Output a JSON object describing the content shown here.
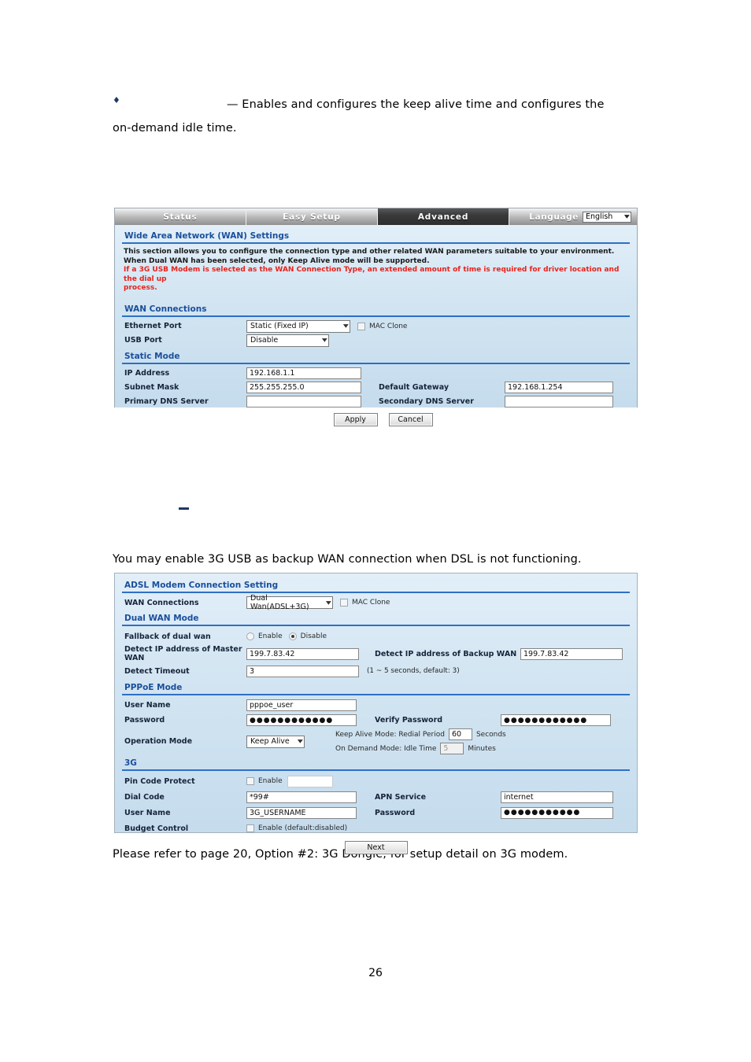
{
  "document": {
    "bullet_glyph": "♦",
    "para1": "— Enables and configures the keep alive time and configures the",
    "para1_line2": "on-demand idle time.",
    "para2": "You may enable 3G USB as backup WAN connection when DSL is not functioning.",
    "para3": "Please refer to page 20, Option #2: 3G Dongle, for setup detail on 3G modem.",
    "page_number": "26"
  },
  "colors": {
    "accent_blue": "#1a4f9c",
    "divider_blue": "#2f6fc4",
    "warning_red": "#e8221c",
    "panel_bg": "#d3e5f2",
    "active_tab": "#2e2e2e"
  },
  "screenshot_wan": {
    "nav": {
      "tabs": [
        {
          "label": "Status",
          "active": false
        },
        {
          "label": "Easy Setup",
          "active": false
        },
        {
          "label": "Advanced",
          "active": true
        }
      ],
      "language_label": "Language",
      "language_value": "English"
    },
    "title": "Wide Area Network (WAN) Settings",
    "notice": {
      "line1": "This section allows you to configure the connection type and other related WAN parameters suitable to your environment.",
      "line2": "When Dual WAN has been selected, only Keep Alive mode will be supported.",
      "line3": "If a 3G USB Modem is selected as the WAN Connection Type, an extended amount of time is required for driver location and the dial up",
      "line4": "process."
    },
    "section_wan_connections": "WAN Connections",
    "ethernet_port": {
      "label": "Ethernet Port",
      "value": "Static (Fixed IP)"
    },
    "mac_clone": {
      "label": "MAC Clone",
      "checked": false
    },
    "usb_port": {
      "label": "USB Port",
      "value": "Disable"
    },
    "section_static_mode": "Static Mode",
    "ip_address": {
      "label": "IP Address",
      "value": "192.168.1.1"
    },
    "subnet_mask": {
      "label": "Subnet Mask",
      "value": "255.255.255.0"
    },
    "default_gateway": {
      "label": "Default Gateway",
      "value": "192.168.1.254"
    },
    "primary_dns": {
      "label": "Primary DNS Server",
      "value": ""
    },
    "secondary_dns": {
      "label": "Secondary DNS Server",
      "value": ""
    },
    "apply_button": "Apply",
    "cancel_button": "Cancel"
  },
  "screenshot_adsl": {
    "title": "ADSL Modem Connection Setting",
    "wan_connections": {
      "label": "WAN Connections",
      "value": "Dual Wan(ADSL+3G)"
    },
    "mac_clone": {
      "label": "MAC Clone",
      "checked": false
    },
    "section_dual_wan_mode": "Dual WAN Mode",
    "fallback": {
      "label": "Fallback of dual wan",
      "option_enable": "Enable",
      "option_disable": "Disable",
      "selected": "Disable"
    },
    "detect_master": {
      "label": "Detect IP address of Master WAN",
      "value": "199.7.83.42"
    },
    "detect_backup": {
      "label": "Detect IP address of Backup WAN",
      "value": "199.7.83.42"
    },
    "detect_timeout": {
      "label": "Detect Timeout",
      "value": "3",
      "hint": "(1 ~ 5 seconds, default: 3)"
    },
    "section_pppoe_mode": "PPPoE Mode",
    "user_name": {
      "label": "User Name",
      "value": "pppoe_user"
    },
    "password": {
      "label": "Password",
      "value": "●●●●●●●●●●●●"
    },
    "verify_password": {
      "label": "Verify Password",
      "value": "●●●●●●●●●●●●"
    },
    "operation_mode": {
      "label": "Operation Mode",
      "value": "Keep Alive"
    },
    "keep_alive": {
      "label": "Keep Alive Mode: Redial Period",
      "value": "60",
      "unit": "Seconds"
    },
    "on_demand": {
      "label": "On Demand Mode: Idle Time",
      "value": "5",
      "unit": "Minutes",
      "disabled": true
    },
    "section_3g": "3G",
    "pin_code_protect": {
      "label": "Pin Code Protect",
      "enable_label": "Enable",
      "checked": false,
      "value": ""
    },
    "dial_code": {
      "label": "Dial Code",
      "value": "*99#"
    },
    "apn_service": {
      "label": "APN Service",
      "value": "internet"
    },
    "g3_user_name": {
      "label": "User Name",
      "value": "3G_USERNAME"
    },
    "g3_password": {
      "label": "Password",
      "value": "●●●●●●●●●●●"
    },
    "budget_control": {
      "label": "Budget Control",
      "enable_label": "Enable (default:disabled)",
      "checked": false
    },
    "next_button": "Next"
  }
}
